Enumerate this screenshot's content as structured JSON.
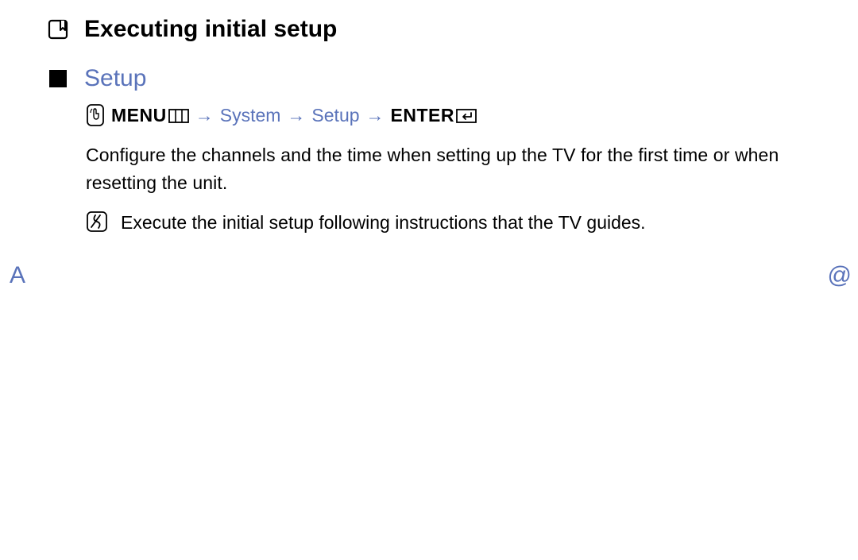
{
  "title": "Executing initial setup",
  "section": "Setup",
  "nav": {
    "menu": "MENU",
    "arrow1": "→",
    "link1": "System",
    "arrow2": "→",
    "link2": "Setup",
    "arrow3": "→",
    "enter": "ENTER"
  },
  "paragraph": "Configure the channels and the time when setting up the TV for the first time or when resetting the unit.",
  "note": "Execute the initial setup following instructions that the TV guides.",
  "side": {
    "a": "A",
    "at": "@"
  }
}
